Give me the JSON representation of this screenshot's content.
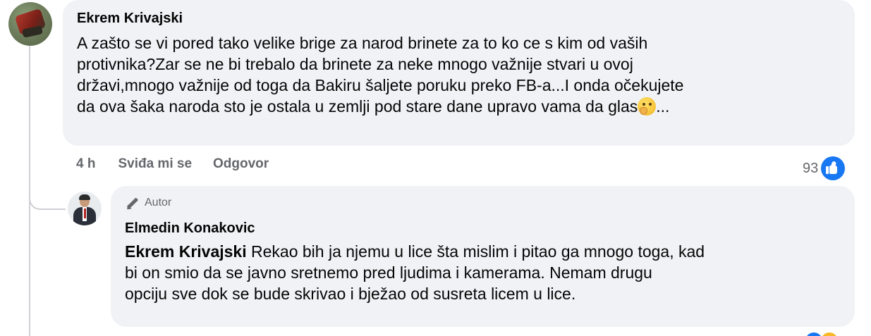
{
  "comment": {
    "author": "Ekrem Krivajski",
    "text_lines": [
      "A zašto se vi pored tako velike brige za narod brinete za to ko ce s kim od vaših",
      "protivnika?Zar se ne bi trebalo da brinete za neke mnogo važnije stvari u ovoj",
      "državi,mnogo važnije od toga da Bakiru šaljete poruku preko FB-a...I onda očekujete",
      "da ova šaka naroda sto je ostala u zemlji pod stare dane upravo vama da glas",
      "..."
    ],
    "timestamp": "4 h",
    "like_label": "Sviđa mi se",
    "reply_label": "Odgovor",
    "reaction_count": "93",
    "reaction_icon": "like-icon",
    "avatar_icon": "avatar"
  },
  "reply": {
    "badge_label": "Autor",
    "badge_icon": "pen-icon",
    "author": "Elmedin Konakovic",
    "mention": "Ekrem Krivajski",
    "text_lines": [
      " Rekao bih ja njemu u lice šta mislim i pitao ga mnogo toga, kad",
      "bi on smio da se javno sretnemo pred ljudima i kamerama. Nemam drugu",
      "opciju sve dok se bude skrivao i bježao od susreta licem u lice."
    ]
  },
  "colors": {
    "bubble_bg": "#f0f2f5",
    "meta_text": "#65676b",
    "like_blue": "#1877f2",
    "thread_line": "#ced0d4"
  }
}
